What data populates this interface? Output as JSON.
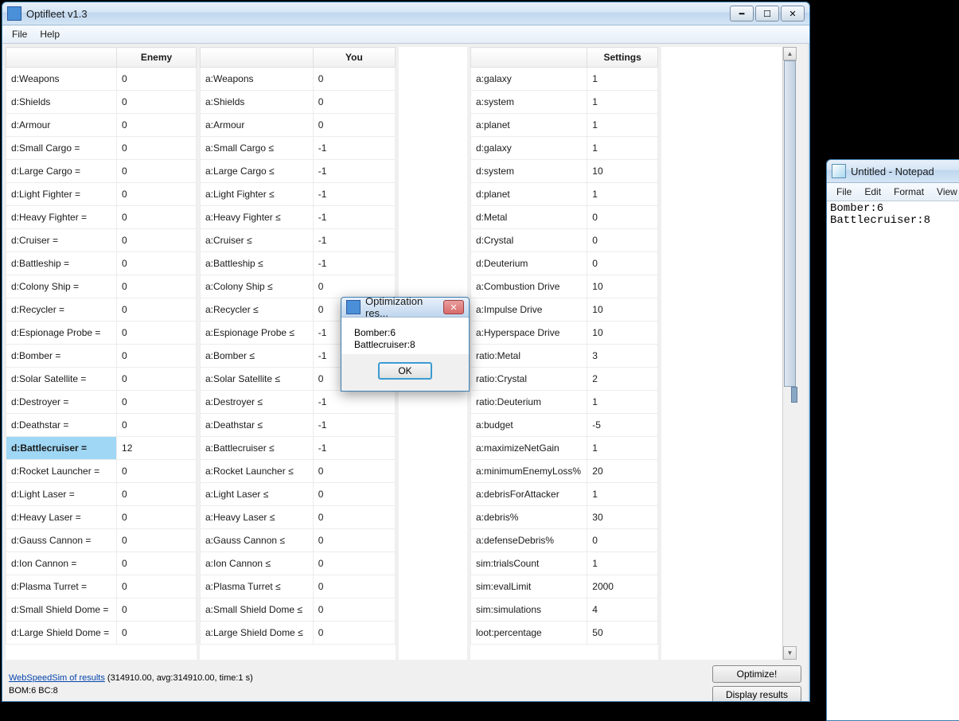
{
  "optifleet": {
    "title": "Optifleet v1.3",
    "menu": {
      "file": "File",
      "help": "Help"
    },
    "headers": {
      "enemy": "Enemy",
      "you": "You",
      "settings": "Settings"
    },
    "enemyRows": [
      {
        "label": "d:Weapons",
        "val": "0",
        "sel": false
      },
      {
        "label": "d:Shields",
        "val": "0",
        "sel": false
      },
      {
        "label": "d:Armour",
        "val": "0",
        "sel": false
      },
      {
        "label": "d:Small Cargo =",
        "val": "0",
        "sel": false
      },
      {
        "label": "d:Large Cargo =",
        "val": "0",
        "sel": false
      },
      {
        "label": "d:Light Fighter =",
        "val": "0",
        "sel": false
      },
      {
        "label": "d:Heavy Fighter =",
        "val": "0",
        "sel": false
      },
      {
        "label": "d:Cruiser =",
        "val": "0",
        "sel": false
      },
      {
        "label": "d:Battleship =",
        "val": "0",
        "sel": false
      },
      {
        "label": "d:Colony Ship =",
        "val": "0",
        "sel": false
      },
      {
        "label": "d:Recycler =",
        "val": "0",
        "sel": false
      },
      {
        "label": "d:Espionage Probe =",
        "val": "0",
        "sel": false
      },
      {
        "label": "d:Bomber =",
        "val": "0",
        "sel": false
      },
      {
        "label": "d:Solar Satellite =",
        "val": "0",
        "sel": false
      },
      {
        "label": "d:Destroyer =",
        "val": "0",
        "sel": false
      },
      {
        "label": "d:Deathstar =",
        "val": "0",
        "sel": false
      },
      {
        "label": "d:Battlecruiser =",
        "val": "12",
        "sel": true
      },
      {
        "label": "d:Rocket Launcher =",
        "val": "0",
        "sel": false
      },
      {
        "label": "d:Light Laser =",
        "val": "0",
        "sel": false
      },
      {
        "label": "d:Heavy Laser =",
        "val": "0",
        "sel": false
      },
      {
        "label": "d:Gauss Cannon =",
        "val": "0",
        "sel": false
      },
      {
        "label": "d:Ion Cannon =",
        "val": "0",
        "sel": false
      },
      {
        "label": "d:Plasma Turret =",
        "val": "0",
        "sel": false
      },
      {
        "label": "d:Small Shield Dome =",
        "val": "0",
        "sel": false
      },
      {
        "label": "d:Large Shield Dome =",
        "val": "0",
        "sel": false
      }
    ],
    "youRows": [
      {
        "label": "a:Weapons",
        "val": "0"
      },
      {
        "label": "a:Shields",
        "val": "0"
      },
      {
        "label": "a:Armour",
        "val": "0"
      },
      {
        "label": "a:Small Cargo ≤",
        "val": "-1"
      },
      {
        "label": "a:Large Cargo ≤",
        "val": "-1"
      },
      {
        "label": "a:Light Fighter ≤",
        "val": "-1"
      },
      {
        "label": "a:Heavy Fighter ≤",
        "val": "-1"
      },
      {
        "label": "a:Cruiser ≤",
        "val": "-1"
      },
      {
        "label": "a:Battleship ≤",
        "val": "-1"
      },
      {
        "label": "a:Colony Ship ≤",
        "val": "0"
      },
      {
        "label": "a:Recycler ≤",
        "val": "0"
      },
      {
        "label": "a:Espionage Probe ≤",
        "val": "-1"
      },
      {
        "label": "a:Bomber ≤",
        "val": "-1"
      },
      {
        "label": "a:Solar Satellite ≤",
        "val": "0"
      },
      {
        "label": "a:Destroyer ≤",
        "val": "-1"
      },
      {
        "label": "a:Deathstar ≤",
        "val": "-1"
      },
      {
        "label": "a:Battlecruiser ≤",
        "val": "-1"
      },
      {
        "label": "a:Rocket Launcher ≤",
        "val": "0"
      },
      {
        "label": "a:Light Laser ≤",
        "val": "0"
      },
      {
        "label": "a:Heavy Laser ≤",
        "val": "0"
      },
      {
        "label": "a:Gauss Cannon ≤",
        "val": "0"
      },
      {
        "label": "a:Ion Cannon ≤",
        "val": "0"
      },
      {
        "label": "a:Plasma Turret ≤",
        "val": "0"
      },
      {
        "label": "a:Small Shield Dome ≤",
        "val": "0"
      },
      {
        "label": "a:Large Shield Dome ≤",
        "val": "0"
      }
    ],
    "settingsRows": [
      {
        "label": "a:galaxy",
        "val": "1"
      },
      {
        "label": "a:system",
        "val": "1"
      },
      {
        "label": "a:planet",
        "val": "1"
      },
      {
        "label": "d:galaxy",
        "val": "1"
      },
      {
        "label": "d:system",
        "val": "10"
      },
      {
        "label": "d:planet",
        "val": "1"
      },
      {
        "label": "d:Metal",
        "val": "0"
      },
      {
        "label": "d:Crystal",
        "val": "0"
      },
      {
        "label": "d:Deuterium",
        "val": "0"
      },
      {
        "label": "a:Combustion Drive",
        "val": "10"
      },
      {
        "label": "a:Impulse Drive",
        "val": "10"
      },
      {
        "label": "a:Hyperspace Drive",
        "val": "10"
      },
      {
        "label": "ratio:Metal",
        "val": "3"
      },
      {
        "label": "ratio:Crystal",
        "val": "2"
      },
      {
        "label": "ratio:Deuterium",
        "val": "1"
      },
      {
        "label": "a:budget",
        "val": "-5"
      },
      {
        "label": "a:maximizeNetGain",
        "val": "1"
      },
      {
        "label": "a:minimumEnemyLoss%",
        "val": "20"
      },
      {
        "label": "a:debrisForAttacker",
        "val": "1"
      },
      {
        "label": "a:debris%",
        "val": "30"
      },
      {
        "label": "a:defenseDebris%",
        "val": "0"
      },
      {
        "label": "sim:trialsCount",
        "val": "1"
      },
      {
        "label": "sim:evalLimit",
        "val": "2000"
      },
      {
        "label": "sim:simulations",
        "val": "4"
      },
      {
        "label": "loot:percentage",
        "val": "50"
      }
    ],
    "status": {
      "link": "WebSpeedSim of results",
      "linktail": " (314910.00, avg:314910.00, time:1 s)",
      "line2": "BOM:6 BC:8",
      "optimize": "Optimize!",
      "display": "Display results"
    }
  },
  "dialog": {
    "title": "Optimization res...",
    "line1": "Bomber:6",
    "line2": "Battlecruiser:8",
    "ok": "OK"
  },
  "notepad": {
    "title": "Untitled - Notepad",
    "menu": {
      "file": "File",
      "edit": "Edit",
      "format": "Format",
      "view": "View"
    },
    "content": "Bomber:6\nBattlecruiser:8"
  }
}
